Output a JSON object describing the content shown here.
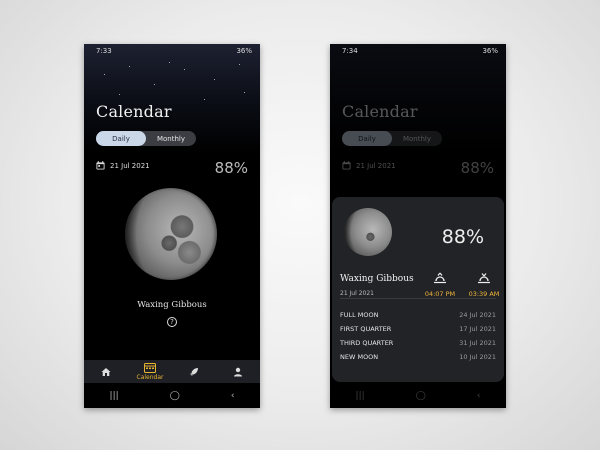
{
  "phone_daily": {
    "status": {
      "time": "7:33",
      "battery": "36%"
    },
    "title": "Calendar",
    "toggle": {
      "daily": "Daily",
      "monthly": "Monthly"
    },
    "date": "21 Jul 2021",
    "illumination": "88%",
    "phase_name": "Waxing Gibbous",
    "nav": {
      "active_label": "Calendar"
    }
  },
  "phone_detail": {
    "status": {
      "time": "7:34",
      "battery": "36%"
    },
    "title": "Calendar",
    "toggle": {
      "daily": "Daily",
      "monthly": "Monthly"
    },
    "date": "21 Jul 2021",
    "illumination": "88%",
    "sheet": {
      "illumination": "88%",
      "phase_name": "Waxing Gibbous",
      "date": "21 Jul 2021",
      "moonrise_time": "04:07 PM",
      "moonset_time": "03:39 AM",
      "upcoming": [
        {
          "name": "FULL MOON",
          "date": "24 Jul 2021"
        },
        {
          "name": "FIRST QUARTER",
          "date": "17 Jul 2021"
        },
        {
          "name": "THIRD QUARTER",
          "date": "31 Jul 2021"
        },
        {
          "name": "NEW MOON",
          "date": "10 Jul 2021"
        }
      ]
    }
  },
  "colors": {
    "accent": "#e8b531",
    "toggle_active": "#c9d7e9",
    "sheet_bg": "#222327"
  },
  "icons": [
    "calendar-icon",
    "home-icon",
    "rocket-icon",
    "person-icon",
    "moonrise-icon",
    "moonset-icon",
    "help-icon"
  ]
}
